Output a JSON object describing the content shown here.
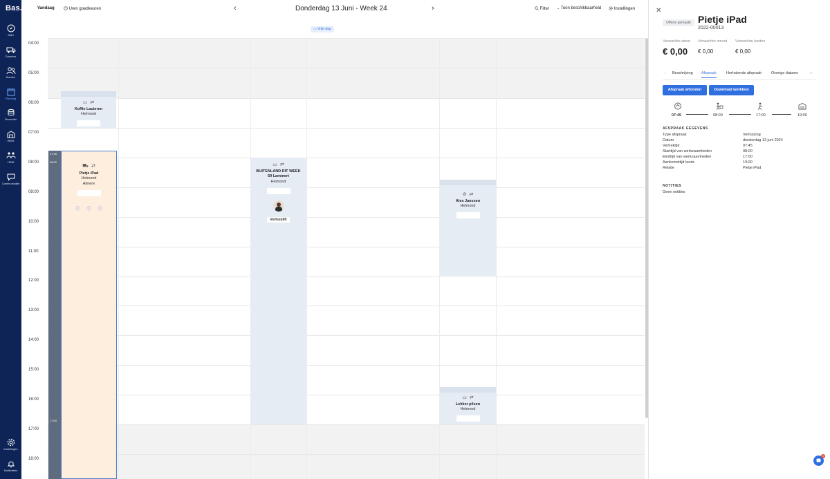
{
  "brand": {
    "logo": "Bas."
  },
  "sidebar": {
    "items": [
      {
        "label": "Start",
        "icon": "compass-icon"
      },
      {
        "label": "Dossiers",
        "icon": "truck-icon"
      },
      {
        "label": "Klanten",
        "icon": "users-icon"
      },
      {
        "label": "Planning",
        "icon": "calendar-icon"
      },
      {
        "label": "Financiën",
        "icon": "coins-icon"
      },
      {
        "label": "WMS",
        "icon": "warehouse-icon"
      },
      {
        "label": "HRM",
        "icon": "people-icon"
      },
      {
        "label": "Communicatie",
        "icon": "chat-icon"
      }
    ],
    "bottom": [
      {
        "label": "Instellingen",
        "icon": "gear-icon"
      },
      {
        "label": "Notificaties",
        "icon": "bell-icon"
      }
    ]
  },
  "toolbar": {
    "today": "Vandaag",
    "approve_hours": "Uren goedkeuren",
    "title": "Donderdag 13 Juni - Week 24",
    "filter": "Filter",
    "availability": "Toon beschikbaarheid",
    "settings": "Instellingen"
  },
  "calendar": {
    "free_day": "Vrije dag",
    "hours": [
      "04:00",
      "05:00",
      "06:00",
      "07:00",
      "08:00",
      "09:00",
      "10:00",
      "11:00",
      "12:00",
      "13:00",
      "14:00",
      "15:00",
      "16:00",
      "17:00",
      "18:00"
    ],
    "timebar": {
      "start": "07:45",
      "work_start": "08:00",
      "end": "17:00"
    },
    "events": {
      "koffie": {
        "title": "Koffie Lauteren",
        "location": "Helmond"
      },
      "pietje": {
        "title": "Pietje iPad",
        "location": "Helmond",
        "destination": "Almere"
      },
      "buitenland": {
        "title": "BUITENLAND RIT WEEK",
        "subtitle": "50 Lammert",
        "location": "Helmond",
        "tag": "Verhuislift"
      },
      "alex": {
        "title": "Alex Janssen",
        "location": "Helmond"
      },
      "lekker": {
        "title": "Lekker pilsen",
        "location": "Helmond"
      }
    }
  },
  "panel": {
    "status_badge": "Offerte gemaakt",
    "title": "Pietje iPad",
    "code": "2022-00013",
    "kpis": [
      {
        "label": "Verwachte winst",
        "value": "€ 0,00"
      },
      {
        "label": "Verwachte omzet",
        "value": "€ 0,00"
      },
      {
        "label": "Verwachte kosten",
        "value": "€ 0,00"
      }
    ],
    "tabs": [
      "Beschrijving",
      "Afspraak",
      "Herhalende afspraak",
      "Overige datums"
    ],
    "buttons": {
      "finish": "Afspraak afronden",
      "download": "Download werkbon"
    },
    "timeline": [
      "07:45",
      "08:00",
      "17:00",
      "19:00"
    ],
    "details_title": "AFSPRAAK GEGEVENS",
    "details": [
      {
        "key": "Type afspraak",
        "value": "Verhuizing"
      },
      {
        "key": "Datum",
        "value": "donderdag 13 juni 2024"
      },
      {
        "key": "Vertrektijd",
        "value": "07:45"
      },
      {
        "key": "Starttijd van werkzaamheden",
        "value": "08:00"
      },
      {
        "key": "Eindtijd van werkzaamheden",
        "value": "17:00"
      },
      {
        "key": "Aankomsttijd loods",
        "value": "19:00"
      },
      {
        "key": "Relatie",
        "value": "Pietje iPad"
      }
    ],
    "notes_title": "NOTITIES",
    "notes": "Geen notities",
    "chat_badge": "1"
  },
  "colors": {
    "sidebar": "#0f2456",
    "accent": "#2f6fe0",
    "event": "#e6ecf4",
    "selected_event": "#fdeede"
  }
}
